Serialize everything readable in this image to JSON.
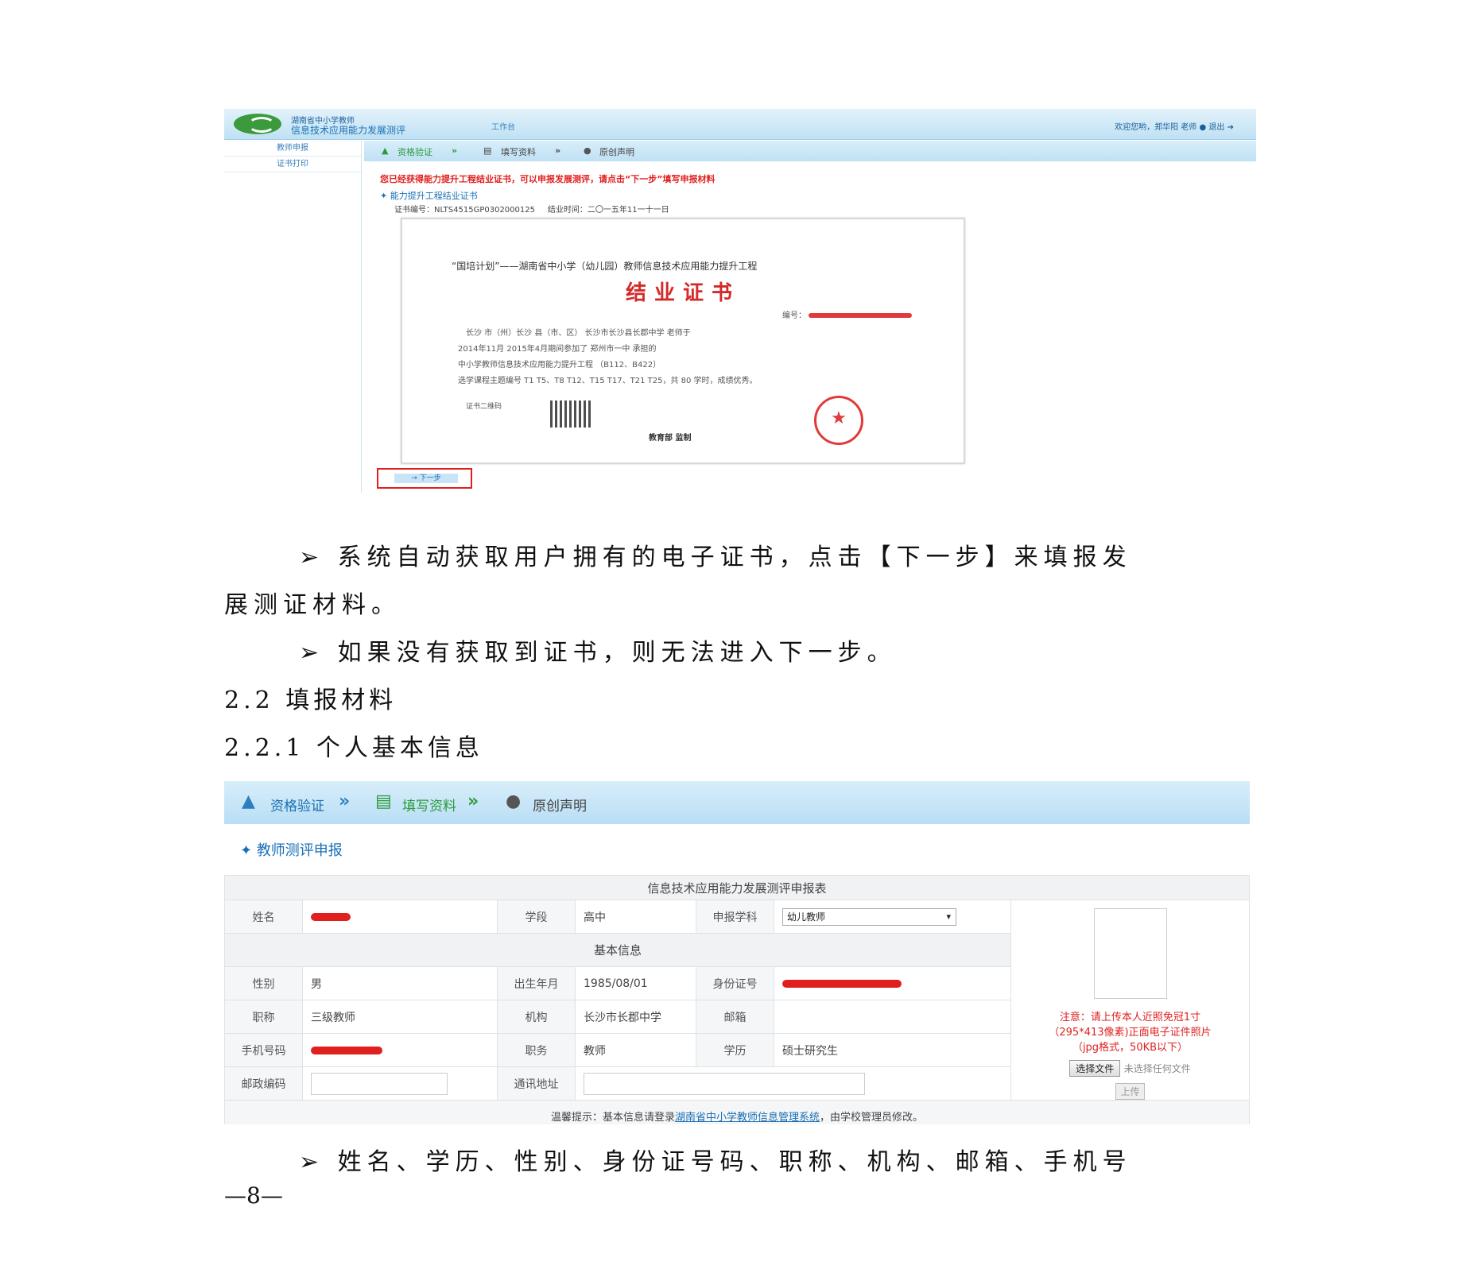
{
  "shot1": {
    "org_line1": "湖南省中小学教师",
    "org_line2": "信息技术应用能力发展测评",
    "tab": "工作台",
    "welcome": "欢迎您哟，郑华阳 老师",
    "logout": "退出",
    "side_items": [
      "教师申报",
      "证书打印"
    ],
    "steps": [
      "资格验证",
      "填写资料",
      "原创声明"
    ],
    "notice": "您已经获得能力提升工程结业证书，可以申报发展测评，请点击“下一步”填写申报材料",
    "cert_section": "能力提升工程结业证书",
    "cert_no": "证书编号：NLTS4515GP0302000125",
    "cert_date": "结业时间：二〇一五年11一十一日",
    "cert": {
      "line1": "“国培计划”——湖南省中小学（幼儿园）教师信息技术应用能力提升工程",
      "title": "结业证书",
      "no_label": "编号：",
      "row1": "长沙  市（州）长沙  县（市、区）   长沙市长沙县长郡中学          老师于",
      "row2": "2014年11月    2015年4月期间参加了           郑州市一中              承担的",
      "row3": "中小学教师信息技术应用能力提升工程                   （B112、B422）",
      "row4": "选学课程主题编号 T1 T5、T8 T12、T15 T17、T21 T25，共 80 学时，成绩优秀。",
      "qr_label": "证书二维码",
      "issuer": "教育部 监制"
    },
    "next_label": "下一步"
  },
  "paragraphs": {
    "p1": "➢ 系统自动获取用户拥有的电子证书，点击【下一步】来填报发",
    "p1b": "展测证材料。",
    "p2": "➢ 如果没有获取到证书，则无法进入下一步。",
    "h1": "2.2 填报材料",
    "h2": "2.2.1 个人基本信息",
    "p3": "➢ 姓名、学历、性别、身份证号码、职称、机构、邮箱、手机号",
    "page_no": "—8—"
  },
  "shot2": {
    "steps": [
      "资格验证",
      "填写资料",
      "原创声明"
    ],
    "panel_title": "教师测评申报",
    "form_title": "信息技术应用能力发展测评申报表",
    "section_basic": "基本信息",
    "labels": {
      "name": "姓名",
      "stage": "学段",
      "subject": "申报学科",
      "gender": "性别",
      "birth": "出生年月",
      "idno": "身份证号",
      "title": "职称",
      "org": "机构",
      "email": "邮箱",
      "phone": "手机号码",
      "duty": "职务",
      "edu": "学历",
      "zip": "邮政编码",
      "address": "通讯地址"
    },
    "values": {
      "stage": "高中",
      "subject": "幼儿教师",
      "gender": "男",
      "birth": "1985/08/01",
      "title": "三级教师",
      "org": "长沙市长郡中学",
      "duty": "教师",
      "edu": "硕士研究生"
    },
    "photo_note1": "注意：请上传本人近照免冠1寸",
    "photo_note2": "（295*413像素)正面电子证件照片",
    "photo_note3": "（jpg格式，50KB以下）",
    "choose_file": "选择文件",
    "no_file": "未选择任何文件",
    "upload": "上传",
    "tip_prefix": "温馨提示：基本信息请登录",
    "tip_link": "湖南省中小学教师信息管理系统",
    "tip_suffix": "，由学校管理员修改。"
  },
  "colors": {
    "accent_blue": "#1a6fb5",
    "alert_red": "#e02020",
    "step_bar": "#bfe1f4"
  }
}
